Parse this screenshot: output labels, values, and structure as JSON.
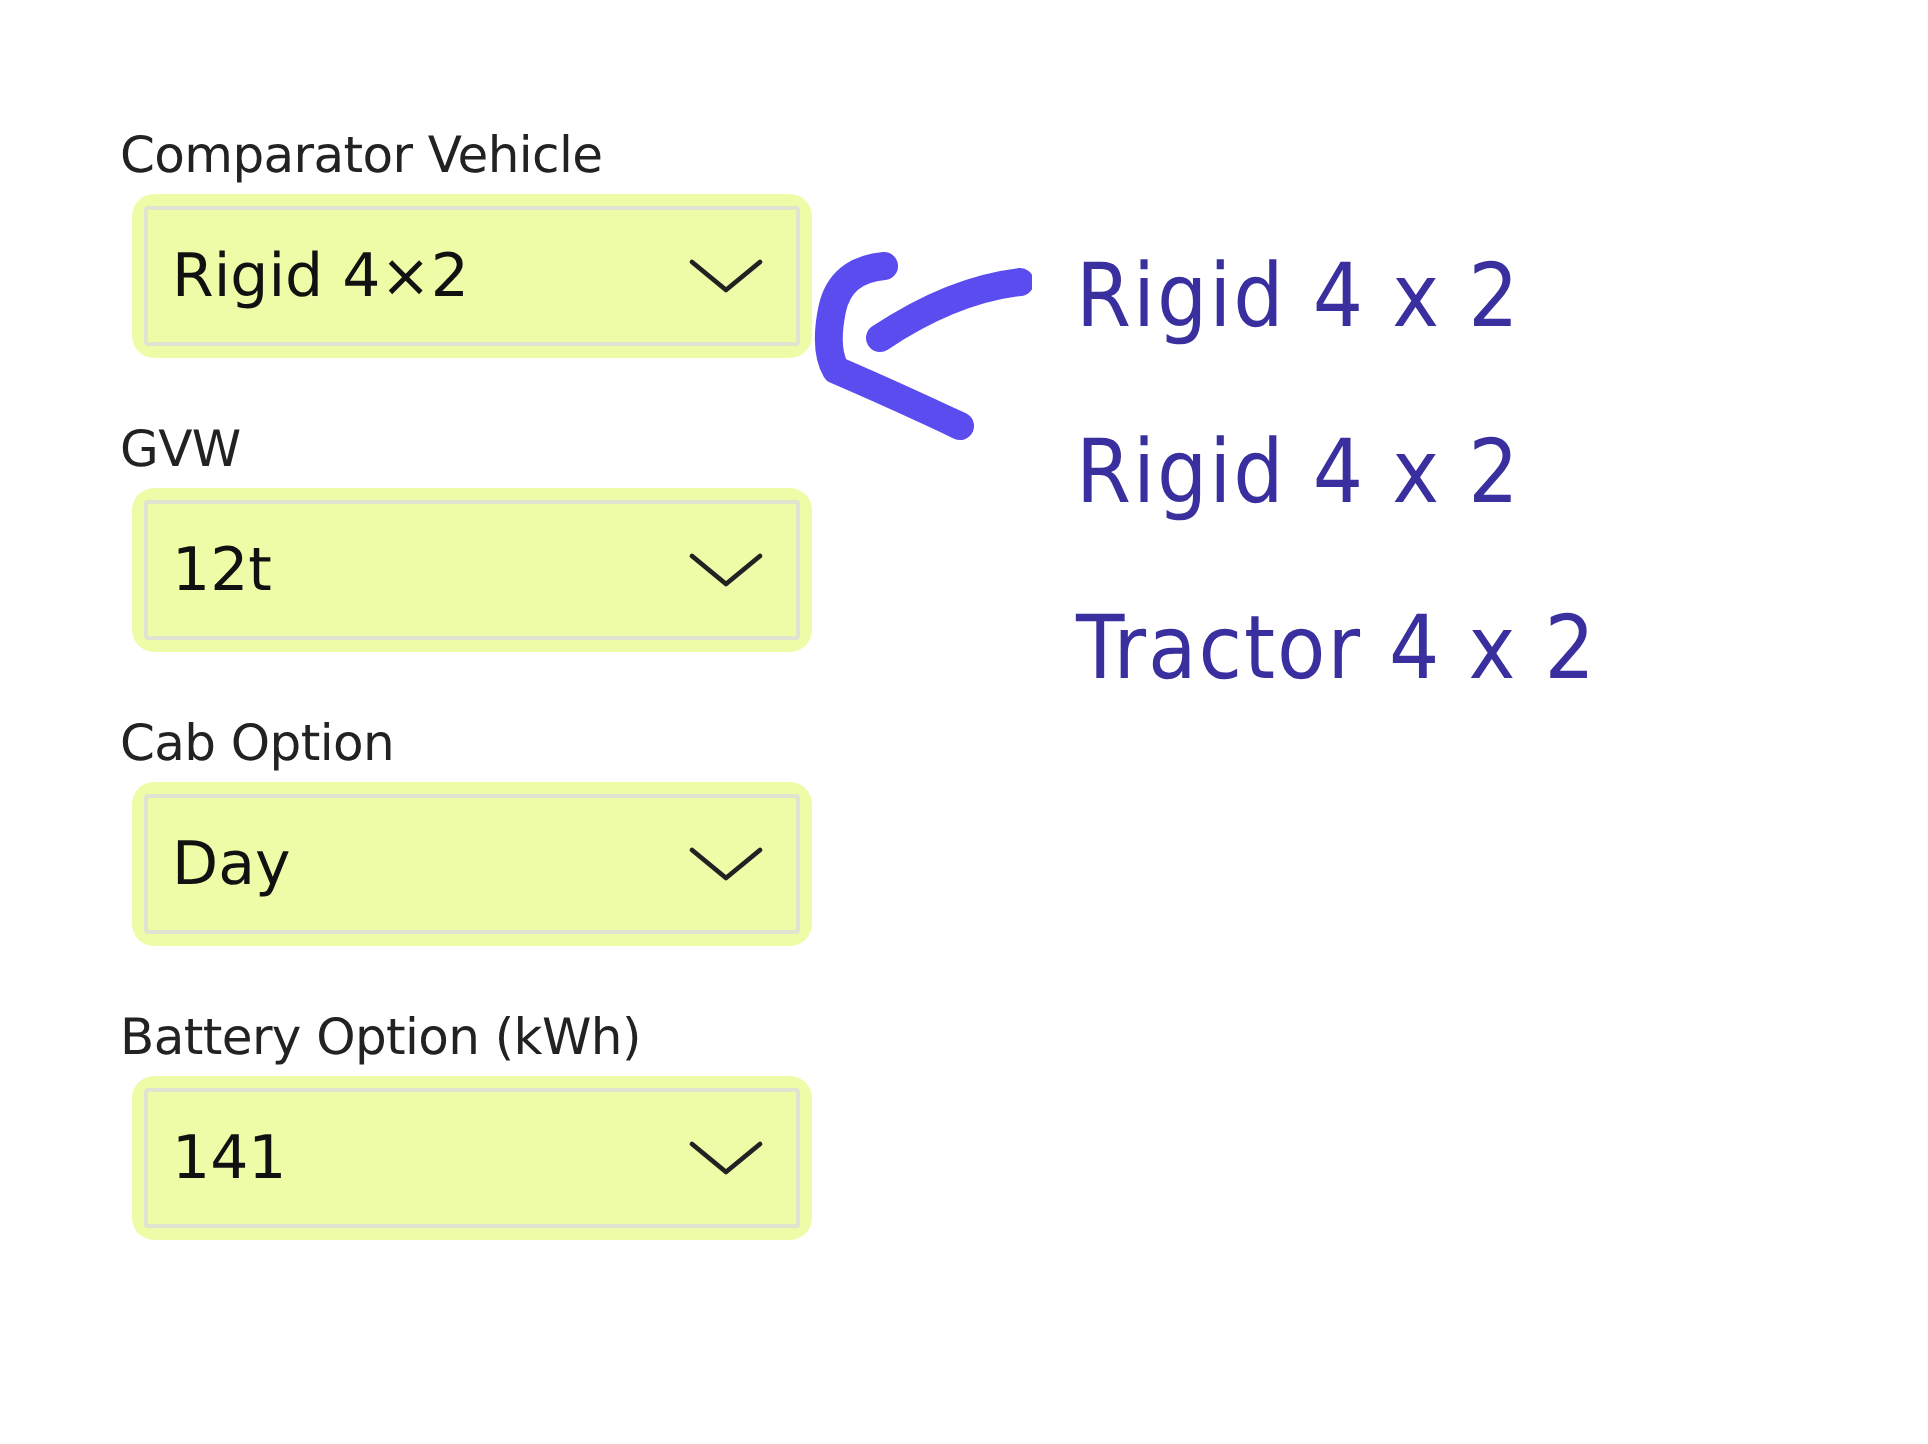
{
  "fields": [
    {
      "label": "Comparator Vehicle",
      "value": "Rigid 4×2"
    },
    {
      "label": "GVW",
      "value": "12t"
    },
    {
      "label": "Cab Option",
      "value": "Day"
    },
    {
      "label": "Battery Option (kWh)",
      "value": "141"
    }
  ],
  "annotation": {
    "notes": [
      "Rigid 4 x 2",
      "Rigid 4 x 2",
      "Tractor 4 x 2"
    ]
  }
}
